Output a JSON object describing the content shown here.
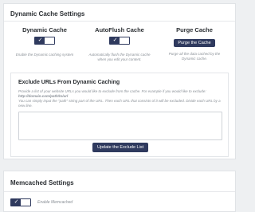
{
  "dynamic_cache_settings": {
    "title": "Dynamic Cache Settings",
    "dynamic_cache": {
      "title": "Dynamic Cache",
      "toggle_state": "on",
      "toggle_mark": "✓",
      "description": "Enable the Dynamic caching system"
    },
    "autoflush_cache": {
      "title": "AutoFlush Cache",
      "toggle_state": "on",
      "toggle_mark": "✓",
      "description": "Automatically flush the Dynamic cache when you edit your content."
    },
    "purge_cache": {
      "title": "Purge Cache",
      "button_label": "Purge the Cache",
      "description": "Purge all the data cached by the Dynamic cache."
    },
    "exclude_urls": {
      "title": "Exclude URLs From Dynamic Caching",
      "description_1": "Provide a list of your website URLs you would like to exclude from the cache. For example if you would like to exclude:",
      "example_url": "http://domain.com/path/to/url",
      "description_2": "You can simply input the \"path\" string part of the URL. Then each URL that consists of it will be excluded. Divide each URL by a new line.",
      "textarea_value": "",
      "button_label": "Update the Exclude List"
    }
  },
  "memcached_settings": {
    "title": "Memcached Settings",
    "toggle_state": "on",
    "toggle_mark": "✓",
    "label": "Enable Memcached"
  },
  "colors": {
    "accent": "#2f3a5e",
    "background": "#eef0f2",
    "card": "#ffffff",
    "muted_text": "#8a9097"
  }
}
